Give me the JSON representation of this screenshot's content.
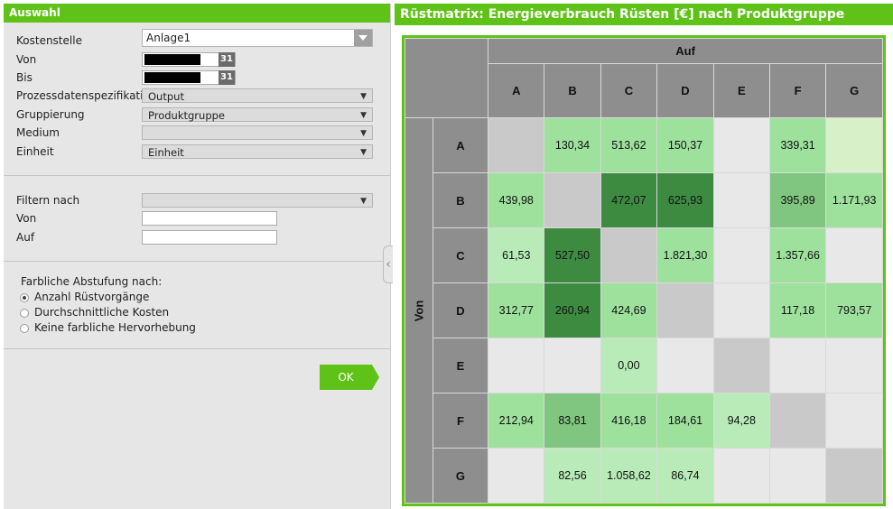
{
  "left_panel": {
    "title": "Auswahl",
    "fields": {
      "kostenstelle": {
        "label": "Kostenstelle",
        "value": "Anlage1"
      },
      "von": {
        "label": "Von",
        "cal": "31"
      },
      "bis": {
        "label": "Bis",
        "cal": "31"
      },
      "prozess": {
        "label": "Prozessdatenspezifikation",
        "value": "Output"
      },
      "gruppierung": {
        "label": "Gruppierung",
        "value": "Produktgruppe"
      },
      "medium": {
        "label": "Medium",
        "value": ""
      },
      "einheit": {
        "label": "Einheit",
        "value": "Einheit"
      }
    },
    "filter": {
      "filtern_nach": {
        "label": "Filtern nach",
        "value": ""
      },
      "von": {
        "label": "Von",
        "value": ""
      },
      "auf": {
        "label": "Auf",
        "value": ""
      }
    },
    "shading": {
      "label": "Farbliche Abstufung nach:",
      "options": [
        "Anzahl Rüstvorgänge",
        "Durchschnittliche Kosten",
        "Keine farbliche Hervorhebung"
      ],
      "selected": 0
    },
    "ok_label": "OK"
  },
  "matrix": {
    "title": "Rüstmatrix: Energieverbrauch Rüsten [€] nach Produktgruppe",
    "col_group_label": "Auf",
    "row_group_label": "Von",
    "columns": [
      "A",
      "B",
      "C",
      "D",
      "E",
      "F",
      "G"
    ],
    "rows": [
      {
        "label": "A",
        "cells": [
          "",
          "130,34",
          "513,62",
          "150,37",
          "",
          "339,31",
          ""
        ]
      },
      {
        "label": "B",
        "cells": [
          "439,98",
          "",
          "472,07",
          "625,93",
          "",
          "395,89",
          "1.171,93"
        ]
      },
      {
        "label": "C",
        "cells": [
          "61,53",
          "527,50",
          "",
          "1.821,30",
          "",
          "1.357,66",
          ""
        ]
      },
      {
        "label": "D",
        "cells": [
          "312,77",
          "260,94",
          "424,69",
          "",
          "",
          "117,18",
          "793,57"
        ]
      },
      {
        "label": "E",
        "cells": [
          "",
          "",
          "0,00",
          "",
          "",
          "",
          ""
        ]
      },
      {
        "label": "F",
        "cells": [
          "212,94",
          "83,81",
          "416,18",
          "184,61",
          "94,28",
          "",
          ""
        ]
      },
      {
        "label": "G",
        "cells": [
          "",
          "82,56",
          "1.058,62",
          "86,74",
          "",
          "",
          ""
        ]
      }
    ],
    "cell_colors": [
      [
        "#c9c9c9",
        "#9de19d",
        "#9de19d",
        "#9de19d",
        "#e8e8e8",
        "#9de19d",
        "#d7f0c8"
      ],
      [
        "#9de19d",
        "#c9c9c9",
        "#3d8b40",
        "#3d8b40",
        "#e8e8e8",
        "#80c680",
        "#9de19d"
      ],
      [
        "#b8ebb8",
        "#3d8b40",
        "#c9c9c9",
        "#9de19d",
        "#e8e8e8",
        "#9de19d",
        "#e8e8e8"
      ],
      [
        "#9de19d",
        "#3d8b40",
        "#9de19d",
        "#c9c9c9",
        "#e8e8e8",
        "#9de19d",
        "#9de19d"
      ],
      [
        "#e8e8e8",
        "#e8e8e8",
        "#b8ebb8",
        "#e8e8e8",
        "#c9c9c9",
        "#e8e8e8",
        "#e8e8e8"
      ],
      [
        "#9de19d",
        "#80c680",
        "#9de19d",
        "#9de19d",
        "#b8ebb8",
        "#c9c9c9",
        "#e8e8e8"
      ],
      [
        "#e8e8e8",
        "#b8ebb8",
        "#b8ebb8",
        "#b8ebb8",
        "#e8e8e8",
        "#e8e8e8",
        "#c9c9c9"
      ]
    ]
  }
}
